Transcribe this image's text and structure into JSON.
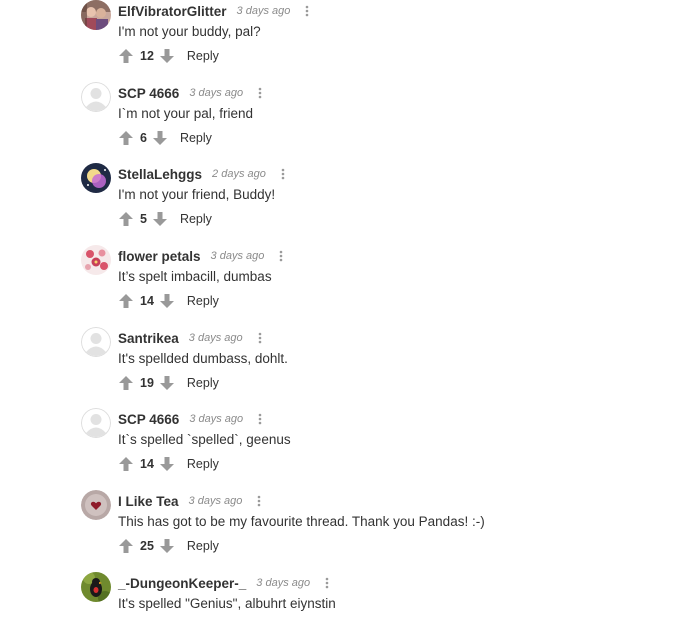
{
  "colors": {
    "text": "#333333",
    "muted": "#8a8a8a",
    "vote_icon": "#999999",
    "avatar_default": "#e4e4e4"
  },
  "comments": [
    {
      "username": "ElfVibratorGlitter",
      "time": "3 days ago",
      "text": "I'm not your buddy, pal?",
      "score": "12",
      "reply_label": "Reply",
      "avatar": "photo-avatar"
    },
    {
      "username": "SCP 4666",
      "time": "3 days ago",
      "text": "I`m not your pal, friend",
      "score": "6",
      "reply_label": "Reply",
      "avatar": "default-avatar"
    },
    {
      "username": "StellaLehggs",
      "time": "2 days ago",
      "text": "I'm not your friend, Buddy!",
      "score": "5",
      "reply_label": "Reply",
      "avatar": "space-avatar"
    },
    {
      "username": "flower petals",
      "time": "3 days ago",
      "text": "It’s spelt imbacill, dumbas",
      "score": "14",
      "reply_label": "Reply",
      "avatar": "floral-avatar"
    },
    {
      "username": "Santrikea",
      "time": "3 days ago",
      "text": "It's spellded dumbass, dohlt.",
      "score": "19",
      "reply_label": "Reply",
      "avatar": "default-avatar"
    },
    {
      "username": "SCP 4666",
      "time": "3 days ago",
      "text": "It`s spelled `spelled`, geenus",
      "score": "14",
      "reply_label": "Reply",
      "avatar": "default-avatar"
    },
    {
      "username": "I Like Tea",
      "time": "3 days ago",
      "text": "This has got to be my favourite thread. Thank you Pandas! :-)",
      "score": "25",
      "reply_label": "Reply",
      "avatar": "heart-avatar"
    },
    {
      "username": "_-DungeonKeeper-_",
      "time": "3 days ago",
      "text": "It's spelled \"Genius\", albuhrt eiynstin",
      "score": "",
      "reply_label": "",
      "avatar": "bird-avatar"
    }
  ]
}
